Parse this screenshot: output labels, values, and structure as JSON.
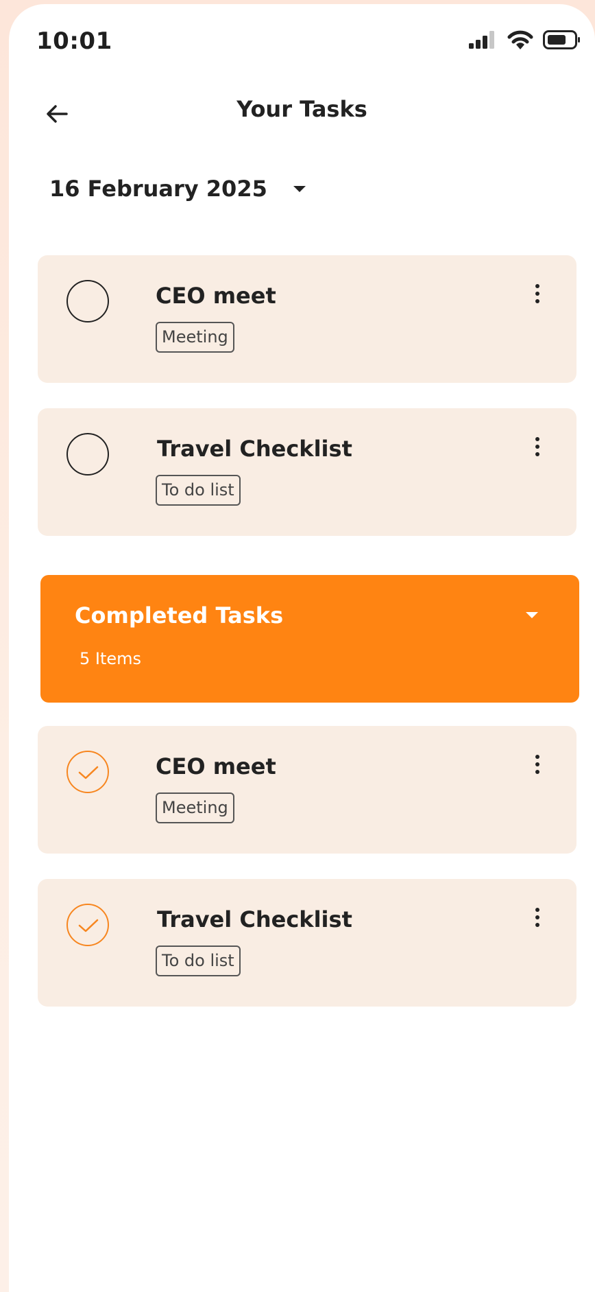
{
  "status_bar": {
    "time": "10:01",
    "icons": [
      "signal-icon",
      "wifi-icon",
      "battery-icon"
    ]
  },
  "header": {
    "title": "Your Tasks",
    "back_icon": "arrow-left-icon"
  },
  "date_selector": {
    "label": "16 February 2025",
    "icon": "caret-down-icon"
  },
  "pending_tasks": [
    {
      "title": "CEO meet",
      "tag": "Meeting"
    },
    {
      "title": "Travel Checklist",
      "tag": "To do list"
    }
  ],
  "completed_section": {
    "title": "Completed Tasks",
    "count": "5 Items",
    "accent": "#ff8412"
  },
  "completed_tasks": [
    {
      "title": "CEO meet",
      "tag": "Meeting"
    },
    {
      "title": "Travel Checklist",
      "tag": "To do list"
    }
  ],
  "colors": {
    "card_bg": "#f9ede3",
    "accent": "#f7861f",
    "text": "#222222"
  }
}
